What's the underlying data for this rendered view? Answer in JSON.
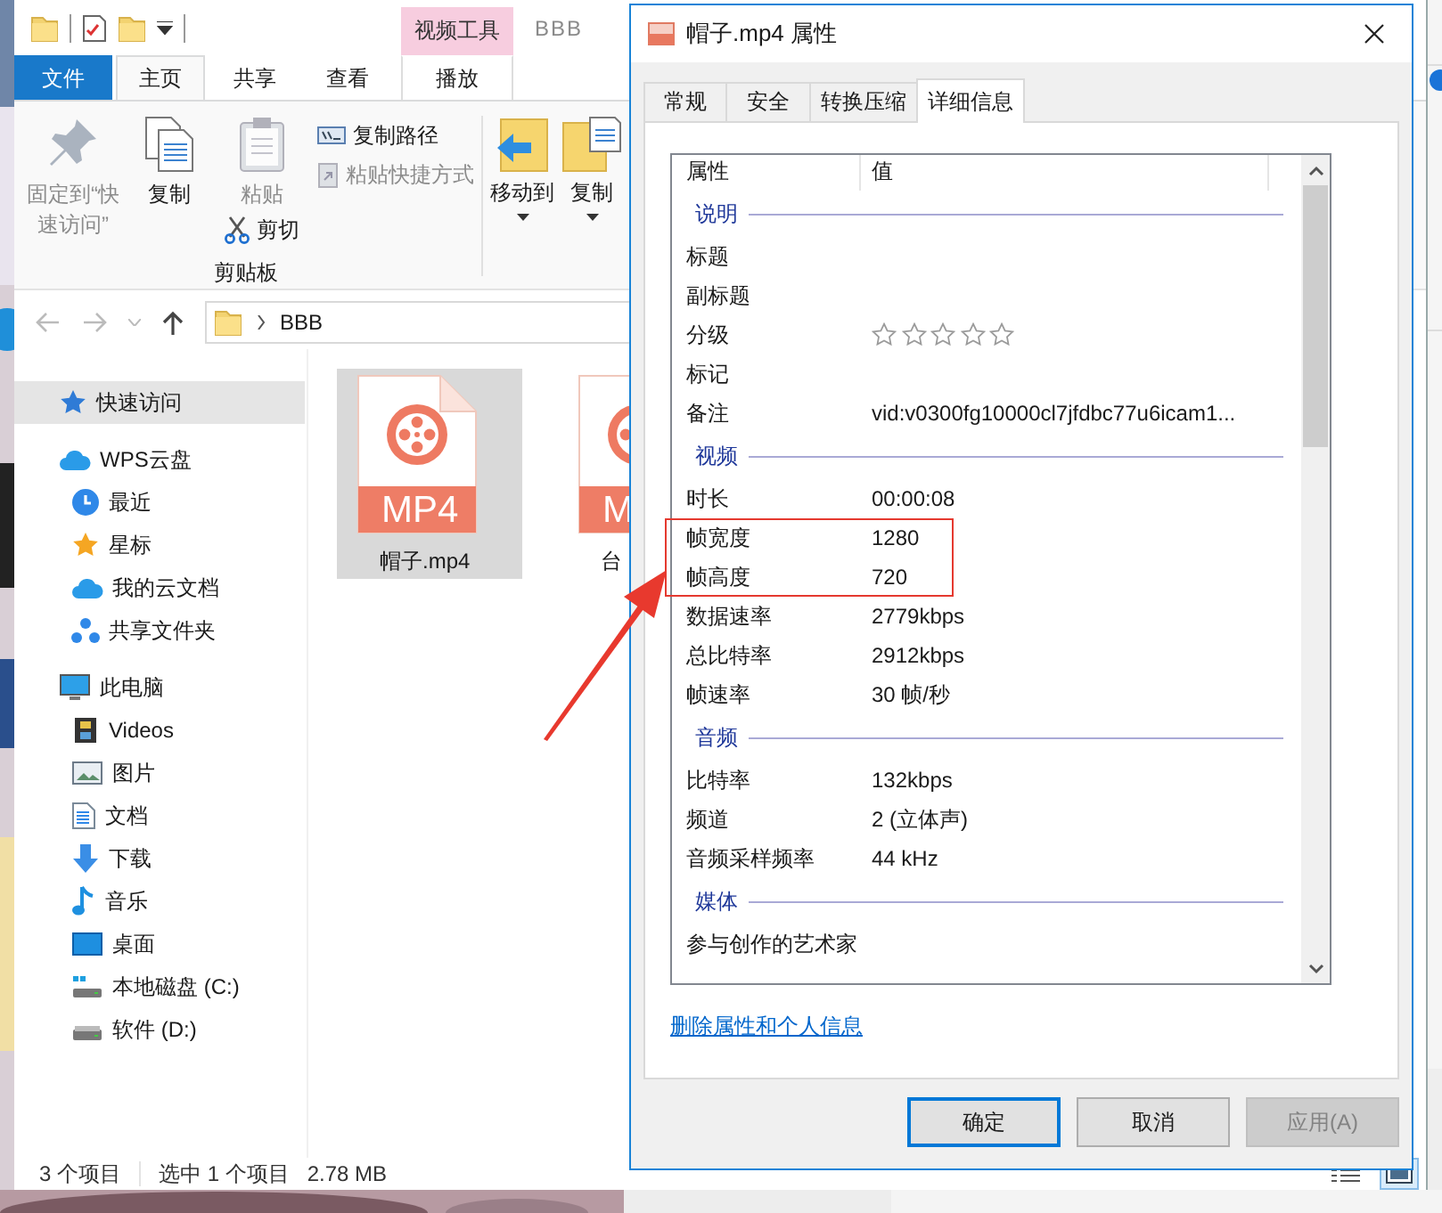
{
  "explorer": {
    "contextual_group": "视频工具",
    "title": "BBB",
    "tabs": [
      {
        "label": "文件",
        "kind": "file",
        "selected": false
      },
      {
        "label": "主页",
        "kind": "normal",
        "selected": true
      },
      {
        "label": "共享",
        "kind": "normal",
        "selected": false
      },
      {
        "label": "查看",
        "kind": "normal",
        "selected": false
      },
      {
        "label": "播放",
        "kind": "contextual",
        "selected": false
      }
    ],
    "clipboard": {
      "pin": {
        "label": "固定到“快速访问”",
        "disabled": true
      },
      "copy": {
        "label": "复制",
        "disabled": false
      },
      "paste": {
        "label": "粘贴",
        "disabled": true
      },
      "cut": {
        "label": "剪切",
        "disabled": false
      },
      "copy_path": {
        "label": "复制路径",
        "disabled": false
      },
      "paste_shortcut": {
        "label": "粘贴快捷方式",
        "disabled": true
      },
      "group_label": "剪贴板"
    },
    "organize": [
      {
        "label": "移动到"
      },
      {
        "label": "复制"
      }
    ],
    "address": [
      "BBB"
    ],
    "sidebar": [
      {
        "label": "快速访问",
        "selected": true
      },
      {
        "label": "WPS云盘",
        "selected": false,
        "children": [
          {
            "label": "最近",
            "selected": false
          },
          {
            "label": "星标",
            "selected": false
          },
          {
            "label": "我的云文档",
            "selected": false
          },
          {
            "label": "共享文件夹",
            "selected": false
          }
        ]
      },
      {
        "label": "此电脑",
        "selected": false,
        "children": [
          {
            "label": "Videos",
            "selected": false
          },
          {
            "label": "图片",
            "selected": false
          },
          {
            "label": "文档",
            "selected": false
          },
          {
            "label": "下载",
            "selected": false
          },
          {
            "label": "音乐",
            "selected": false
          },
          {
            "label": "桌面",
            "selected": false
          },
          {
            "label": "本地磁盘 (C:)",
            "selected": false
          },
          {
            "label": "软件 (D:)",
            "selected": false
          }
        ]
      }
    ],
    "files": [
      {
        "name": "帽子.mp4",
        "badge": "MP4",
        "selected": true
      },
      {
        "name": "台",
        "badge": "M",
        "selected": false
      }
    ],
    "status_bar": {
      "items": "3 个项目",
      "selection": "选中 1 个项目",
      "size": "2.78 MB",
      "views": [
        {
          "selected": false
        },
        {
          "selected": true
        }
      ]
    }
  },
  "dialog": {
    "title": "帽子.mp4 属性",
    "tabs": [
      {
        "label": "常规",
        "selected": false
      },
      {
        "label": "安全",
        "selected": false
      },
      {
        "label": "转换压缩",
        "selected": false
      },
      {
        "label": "详细信息",
        "selected": true
      }
    ],
    "columns": [
      "属性",
      "值"
    ],
    "rows": [
      {
        "kind": "group",
        "label": "说明"
      },
      {
        "kind": "property",
        "name": "标题",
        "highlighted": false
      },
      {
        "kind": "property",
        "name": "副标题",
        "highlighted": false
      },
      {
        "kind": "rating",
        "name": "分级",
        "stars": 0,
        "highlighted": false
      },
      {
        "kind": "property",
        "name": "标记",
        "highlighted": false
      },
      {
        "kind": "property",
        "name": "备注",
        "value": "vid:v0300fg10000cl7jfdbc77u6icam1...",
        "highlighted": false
      },
      {
        "kind": "group",
        "label": "视频"
      },
      {
        "kind": "property",
        "name": "时长",
        "value": "00:00:08",
        "highlighted": false
      },
      {
        "kind": "property",
        "name": "帧宽度",
        "value": "1280",
        "highlighted": true
      },
      {
        "kind": "property",
        "name": "帧高度",
        "value": "720",
        "highlighted": true
      },
      {
        "kind": "property",
        "name": "数据速率",
        "value": "2779kbps",
        "highlighted": false
      },
      {
        "kind": "property",
        "name": "总比特率",
        "value": "2912kbps",
        "highlighted": false
      },
      {
        "kind": "property",
        "name": "帧速率",
        "value": "30 帧/秒",
        "highlighted": false
      },
      {
        "kind": "group",
        "label": "音频"
      },
      {
        "kind": "property",
        "name": "比特率",
        "value": "132kbps",
        "highlighted": false
      },
      {
        "kind": "property",
        "name": "频道",
        "value": "2 (立体声)",
        "highlighted": false
      },
      {
        "kind": "property",
        "name": "音频采样频率",
        "value": "44 kHz",
        "highlighted": false
      },
      {
        "kind": "group",
        "label": "媒体"
      },
      {
        "kind": "property",
        "name": "参与创作的艺术家",
        "highlighted": false
      }
    ],
    "link": "删除属性和个人信息",
    "buttons": [
      {
        "label": "确定",
        "kind": "default",
        "disabled": false
      },
      {
        "label": "取消",
        "kind": "normal",
        "disabled": false
      },
      {
        "label": "应用(A)",
        "kind": "normal",
        "disabled": true
      }
    ]
  }
}
